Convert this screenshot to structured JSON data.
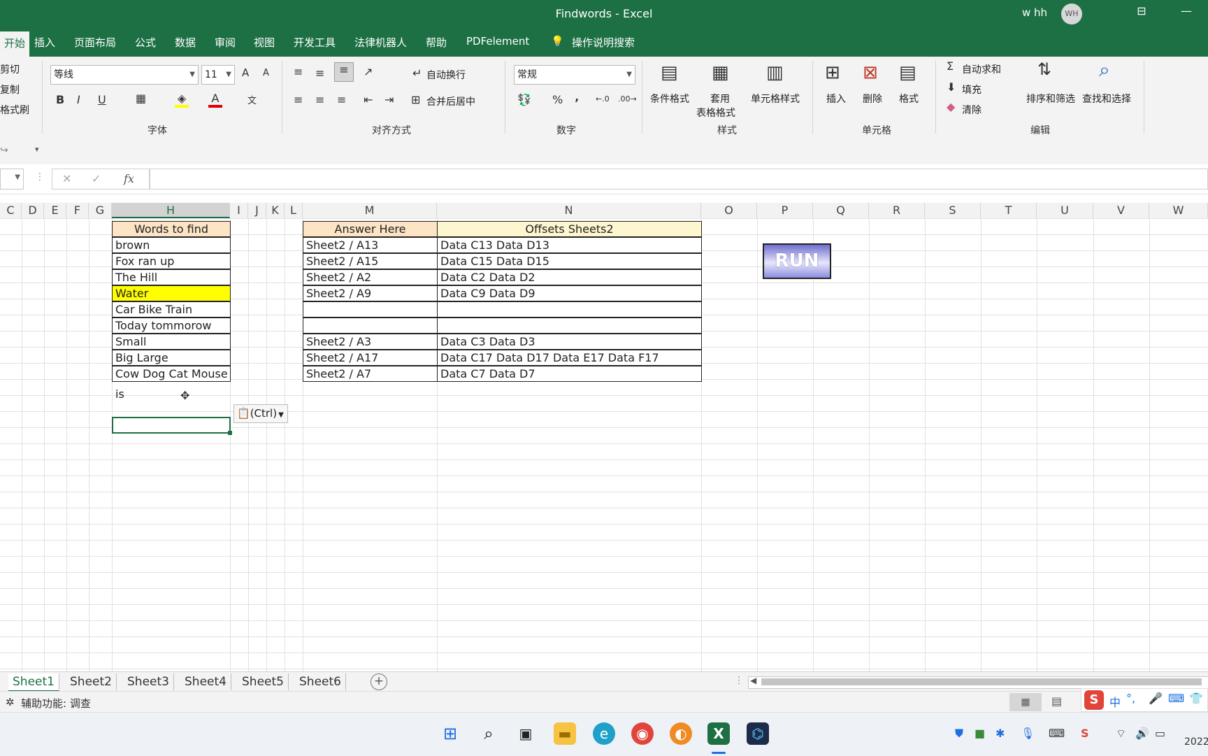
{
  "window": {
    "title": "Findwords  -  Excel",
    "user": "w hh",
    "avatar": "WH"
  },
  "tabs": [
    "开始",
    "插入",
    "页面布局",
    "公式",
    "数据",
    "审阅",
    "视图",
    "开发工具",
    "法律机器人",
    "帮助",
    "PDFelement",
    "操作说明搜索"
  ],
  "ribbon": {
    "clipboard": {
      "cut": "剪切",
      "copy": "复制",
      "format_painter": "格式刷"
    },
    "font": {
      "name": "等线",
      "size": "11",
      "label": "字体",
      "bold": "B",
      "italic": "I",
      "underline": "U",
      "grow": "A",
      "shrink": "A",
      "color_letter": "A",
      "phonetic": "文"
    },
    "alignment": {
      "wrap": "自动换行",
      "merge": "合并后居中",
      "label": "对齐方式"
    },
    "number": {
      "format": "常规",
      "percent": "%",
      "comma": "‚",
      "label": "数字"
    },
    "styles": {
      "conditional": "条件格式",
      "table_fmt_1": "套用",
      "table_fmt_2": "表格格式",
      "cell_styles": "单元格样式",
      "label": "样式"
    },
    "cells": {
      "insert": "插入",
      "delete": "删除",
      "format": "格式",
      "label": "单元格"
    },
    "editing": {
      "autosum": "自动求和",
      "fill": "填充",
      "clear": "清除",
      "sort_filter": "排序和筛选",
      "find_select": "查找和选择",
      "label": "编辑"
    }
  },
  "formula": {
    "fx": "fx"
  },
  "columns": [
    "C",
    "D",
    "E",
    "F",
    "G",
    "H",
    "I",
    "J",
    "K",
    "L",
    "M",
    "N",
    "O",
    "P",
    "Q",
    "R",
    "S",
    "T",
    "U",
    "V",
    "W"
  ],
  "words": {
    "header": "Words to find",
    "rows": [
      "brown",
      "Fox ran up",
      "The Hill",
      "Water",
      "Car Bike Train",
      "Today tommorow",
      "Small",
      "Big Large",
      "Cow Dog Cat Mouse"
    ],
    "extra": "is",
    "highlight_color": "#ffff00",
    "header_color": "#fce4c4"
  },
  "answers": {
    "header_m": "Answer Here",
    "header_n": "Offsets Sheets2",
    "rows": [
      {
        "m": "Sheet2 / A13",
        "n": "Data C13 Data D13"
      },
      {
        "m": "Sheet2 / A15",
        "n": "Data C15 Data D15"
      },
      {
        "m": "Sheet2 / A2",
        "n": "Data C2 Data D2"
      },
      {
        "m": "Sheet2 / A9",
        "n": "Data C9 Data D9"
      },
      {
        "m": "",
        "n": ""
      },
      {
        "m": "",
        "n": ""
      },
      {
        "m": "Sheet2 / A3",
        "n": "Data C3 Data D3"
      },
      {
        "m": "Sheet2 / A17",
        "n": "Data C17 Data D17 Data E17 Data F17"
      },
      {
        "m": "Sheet2 / A7",
        "n": "Data C7 Data D7"
      }
    ]
  },
  "run_button": "RUN",
  "paste_options": "(Ctrl)",
  "sheets": [
    "Sheet1",
    "Sheet2",
    "Sheet3",
    "Sheet4",
    "Sheet5",
    "Sheet6"
  ],
  "status": {
    "accessibility": "辅助功能: 调查"
  },
  "taskbar": {
    "ime_1": "中",
    "ime_2": "°,",
    "clock": "2022"
  },
  "colors": {
    "excel_green": "#1d7044",
    "ribbon_bg": "#f3f3f3"
  }
}
